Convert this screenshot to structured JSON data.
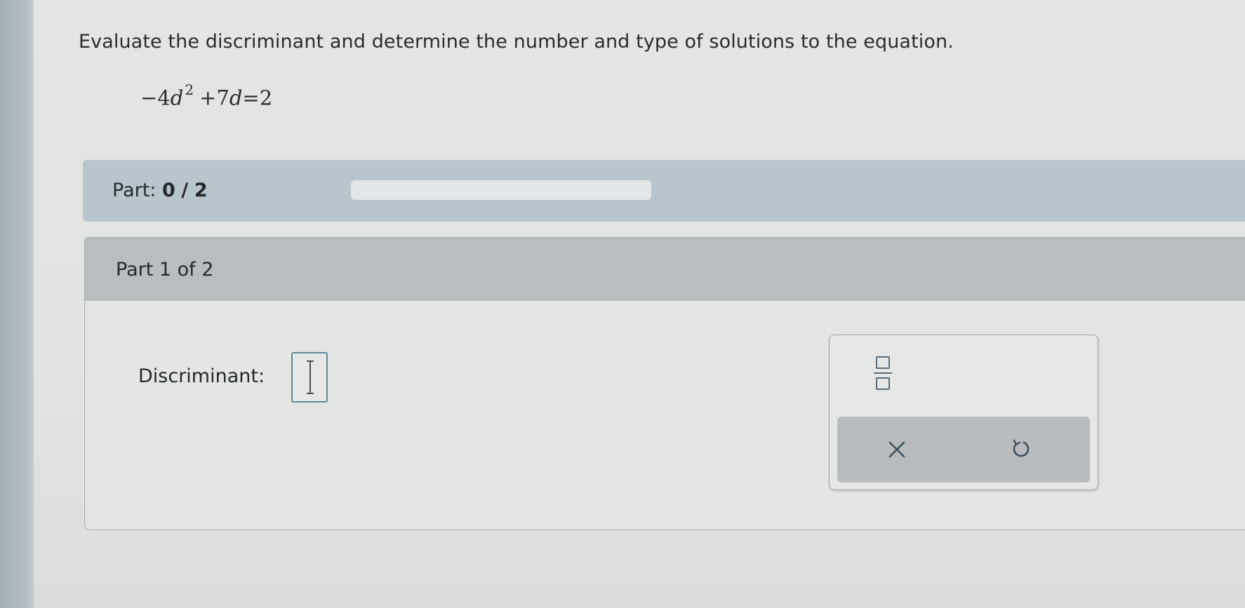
{
  "question": {
    "instruction": "Evaluate the discriminant and determine the number and type of solutions to the equation.",
    "equation": {
      "minus_coef": "−4",
      "var1": "d",
      "exponent": "2",
      "middle": "+7",
      "var2": "d",
      "rhs": "=2"
    }
  },
  "progress": {
    "label": "Part:",
    "current": "0",
    "separator": "/",
    "total": "2",
    "fraction": 0
  },
  "part": {
    "title": "Part 1 of 2",
    "field_label": "Discriminant:",
    "field_value": ""
  },
  "keypad": {
    "icons": [
      "fraction-icon",
      "close-icon",
      "undo-icon"
    ],
    "accent": "#5d8a9a"
  }
}
